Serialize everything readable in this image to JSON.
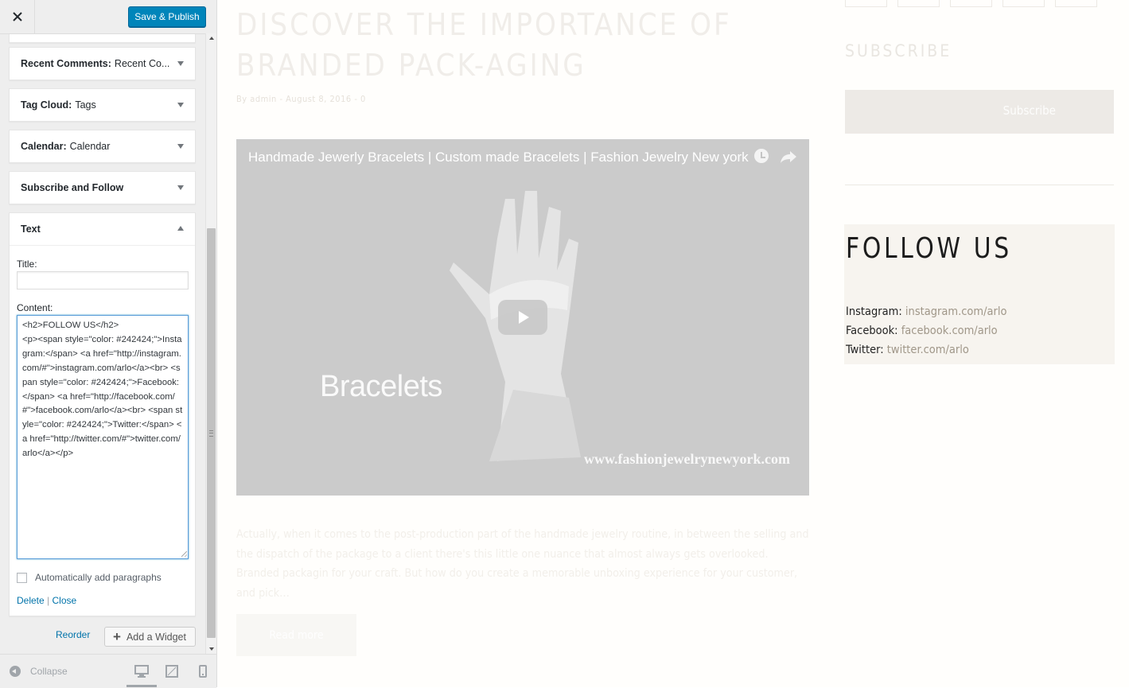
{
  "topbar": {
    "close_icon": "close-icon",
    "publish_label": "Save & Publish",
    "publish_color": "#0085ba"
  },
  "widgets": [
    {
      "name": "Recent Comments:",
      "sub": "Recent Co..."
    },
    {
      "name": "Tag Cloud:",
      "sub": "Tags"
    },
    {
      "name": "Calendar:",
      "sub": "Calendar"
    },
    {
      "name": "Subscribe and Follow",
      "sub": ""
    }
  ],
  "text_widget": {
    "name": "Text",
    "title_label": "Title:",
    "title_value": "",
    "content_label": "Content:",
    "content_value": "<h2>FOLLOW US</h2>\n<p><span style=\"color: #242424;\">Instagram:</span> <a href=\"http://instagram.com/#\">instagram.com/arlo</a><br> <span style=\"color: #242424;\">Facebook:</span> <a href=\"http://facebook.com/#\">facebook.com/arlo</a><br> <span style=\"color: #242424;\">Twitter:</span> <a href=\"http://twitter.com/#\">twitter.com/arlo</a></p>",
    "autop_label": "Automatically add paragraphs",
    "autop_checked": false,
    "delete_label": "Delete",
    "separator": "|",
    "close_label": "Close"
  },
  "actions": {
    "reorder_label": "Reorder",
    "add_widget_label": "Add a Widget"
  },
  "footer": {
    "collapse_label": "Collapse",
    "devices": [
      "desktop-icon",
      "tablet-icon",
      "mobile-icon"
    ],
    "active_device": "desktop"
  },
  "preview": {
    "post_title": "Discover the importance of branded pack-aging",
    "post_meta": "By admin - August 8, 2016 - 0",
    "video": {
      "title": "Handmade Jewerly Bracelets | Custom made Bracelets | Fashion Jewelry New york",
      "overlay_text": "Bracelets",
      "site_text": "www.fashionjewelrynewyork.com",
      "icons": [
        "watch-later-icon",
        "share-icon",
        "play-icon"
      ]
    },
    "excerpt": "Actually, when it comes to the post-production part of the handmade jewelry routine, in between the selling and the dispatch of the package to a client there's this little one nuance that almost always gets overlooked. Branded packagin for your craft. But how do you create a memorable unboxing experience for your customer, and pick…",
    "read_more": "Read more",
    "subscribe_heading": "SUBSCRIBE",
    "subscribe_button": "Subscribe",
    "follow": {
      "title": "FOLLOW US",
      "instagram_label": "Instagram:",
      "instagram_link": "instagram.com/arlo",
      "facebook_label": "Facebook:",
      "facebook_link": "facebook.com/arlo",
      "twitter_label": "Twitter:",
      "twitter_link": "twitter.com/arlo"
    }
  }
}
